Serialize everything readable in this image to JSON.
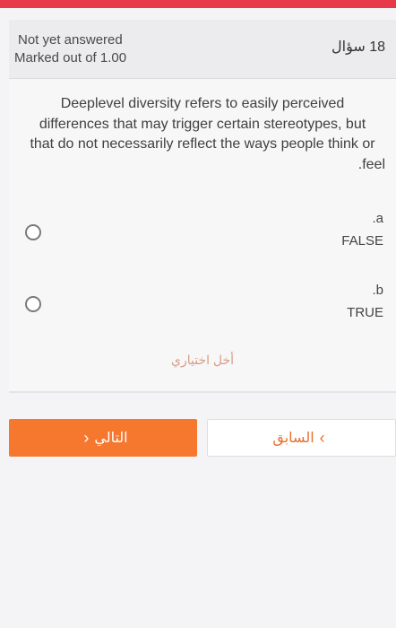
{
  "header": {
    "status": "Not yet answered",
    "marks": "Marked out of 1.00",
    "question_label": "18 سؤال"
  },
  "question": {
    "lines": [
      "Deeplevel diversity refers to easily perceived",
      "differences that may trigger certain stereotypes, but",
      "that do not necessarily reflect the ways people think or",
      ".feel"
    ]
  },
  "options": [
    {
      "letter": ".a",
      "label": "FALSE"
    },
    {
      "letter": ".b",
      "label": "TRUE"
    }
  ],
  "clear_choice": "أخل اختياري",
  "nav": {
    "next_label": "التالي",
    "next_icon": "chevron-left-icon",
    "prev_label": "السابق",
    "prev_icon": "chevron-right-icon"
  },
  "colors": {
    "top_strip": "#e8394a",
    "next_button": "#f6782f",
    "prev_text": "#e86f2d"
  }
}
